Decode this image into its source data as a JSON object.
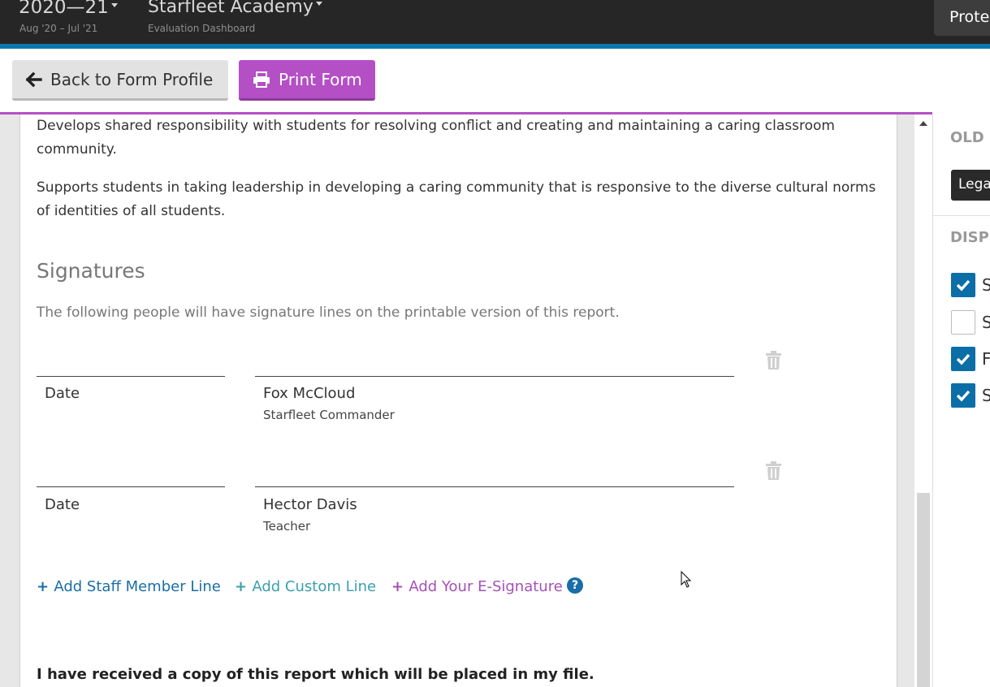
{
  "header": {
    "year": "2020—21",
    "year_range": "Aug '20 – Jul '21",
    "org": "Starfleet Academy",
    "org_sub": "Evaluation Dashboard",
    "right_button": "Prote"
  },
  "toolbar": {
    "back_label": "Back to Form Profile",
    "print_label": "Print Form"
  },
  "content": {
    "para1": "Develops shared responsibility with students for resolving conflict and creating and maintaining a caring classroom community.",
    "para2": "Supports students in taking leadership in developing a caring community that is responsive to the diverse cultural norms of identities of all students.",
    "signatures_heading": "Signatures",
    "signatures_desc": "The following people will have signature lines on the printable version of this report.",
    "signature_lines": [
      {
        "date_label": "Date",
        "name": "Fox McCloud",
        "role": "Starfleet Commander"
      },
      {
        "date_label": "Date",
        "name": "Hector Davis",
        "role": "Teacher"
      }
    ],
    "add_staff": "Add Staff Member Line",
    "add_custom": "Add Custom Line",
    "add_esig": "Add Your E-Signature",
    "help_glyph": "?",
    "acknowledgement": "I have received a copy of this report which will be placed in my file."
  },
  "right_panel": {
    "old_heading": "OLD I",
    "legacy_button": "Lega",
    "display_heading": "DISPL",
    "options": [
      {
        "letter": "S",
        "checked": true
      },
      {
        "letter": "S",
        "checked": false
      },
      {
        "letter": "F",
        "checked": true
      },
      {
        "letter": "S",
        "checked": true
      }
    ]
  },
  "colors": {
    "accent_blue": "#0b78ad",
    "accent_purple": "#b44fc6",
    "link_blue": "#1a6ea7",
    "link_teal": "#3a9fad",
    "link_purple": "#a550b8"
  },
  "icons": [
    "arrow-left-icon",
    "printer-icon",
    "trash-icon",
    "plus-icon",
    "help-circle-icon",
    "check-icon",
    "mouse-cursor-icon"
  ]
}
